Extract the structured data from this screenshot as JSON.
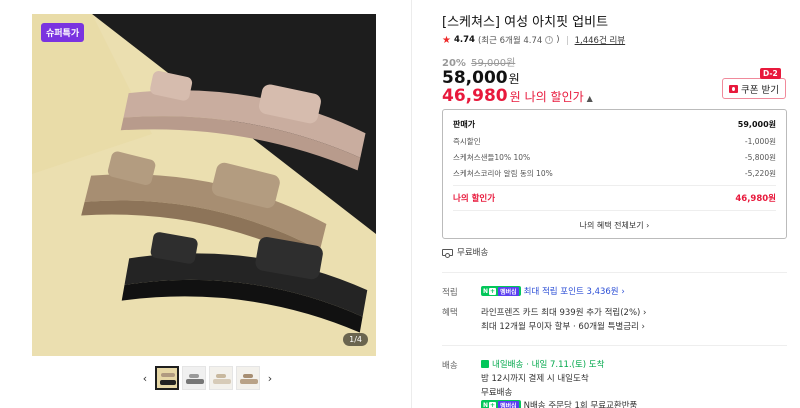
{
  "gallery": {
    "badge": "슈퍼특가",
    "page_indicator": "1/4",
    "thumbnails": [
      "black-sandal",
      "grey-sandal",
      "beige-sandal",
      "tan-sandal"
    ],
    "active_index": 0
  },
  "product": {
    "title": "[스케쳐스] 여성 아치핏 업비트",
    "rating": "4.74",
    "rating_detail": "(최근 6개월 4.74",
    "rating_detail_close": ")",
    "review_count": "1,446건 리뷰",
    "discount_rate": "20%",
    "list_price": "59,000원",
    "sale_price": "58,000",
    "won": "원",
    "my_price": "46,980",
    "my_price_label": "나의 할인가",
    "coupon": {
      "label": "쿠폰 받기",
      "dday": "D-2"
    }
  },
  "price_box": {
    "rows": [
      {
        "label": "판매가",
        "value": "59,000원"
      },
      {
        "label": "즉시할인",
        "value": "-1,000원"
      },
      {
        "label": "스케쳐스샌들10% 10%",
        "value": "-5,800원"
      },
      {
        "label": "스케쳐스코리아 알림 동의 10%",
        "value": "-5,220원"
      }
    ],
    "total": {
      "label": "나의 할인가",
      "value": "46,980원"
    },
    "more": "나의 혜택 전체보기 ›"
  },
  "shipping_summary": "무료배송",
  "benefits": {
    "point_label": "적립",
    "point_badge_n": "N",
    "point_badge_plus": "+",
    "point_badge_member": "멤버십",
    "point_text": "최대 적립 포인트 3,436원 ›",
    "perk_label": "혜택",
    "perk_lines": [
      "라인프렌즈 카드 최대 939원 추가 적립(2%) ›",
      "최대 12개월 무이자 할부 · 60개월 특별금리 ›"
    ],
    "delivery_label": "배송",
    "delivery_today": "내일배송",
    "delivery_eta": "· 내일 7.11.(토) 도착",
    "delivery_line2": "밤 12시까지 결제 시 내일도착",
    "delivery_line3": "무료배송",
    "delivery_line4": "N배송 주문당 1회 무료교환반품"
  },
  "colors": {
    "accent": "#e8193c",
    "badge": "#7a33e0",
    "naver_green": "#03c75a",
    "link_blue": "#2c4fd6"
  }
}
